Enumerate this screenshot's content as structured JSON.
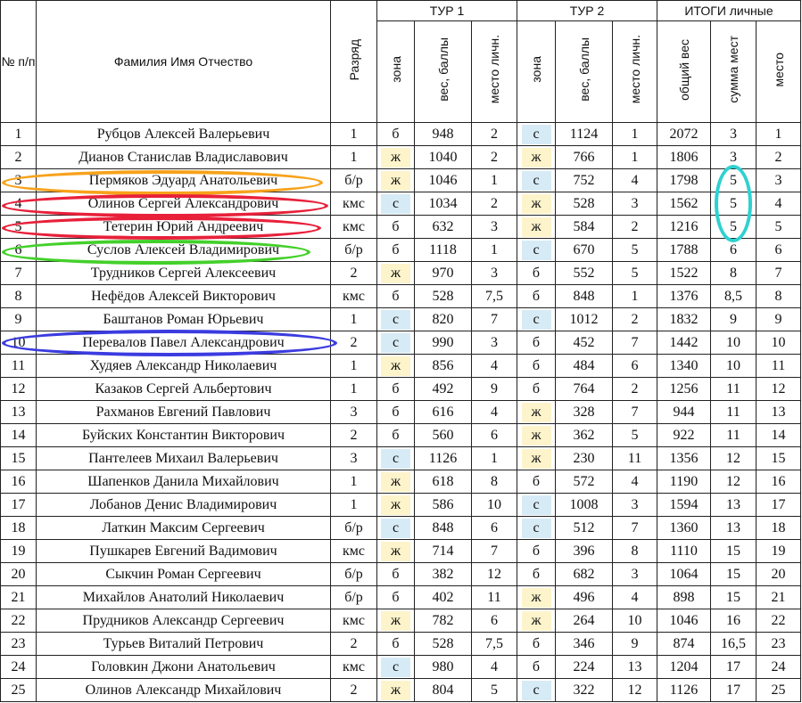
{
  "header": {
    "num": "№ п/п",
    "name": "Фамилия Имя Отчество",
    "rank": "Разряд",
    "tour1": "ТУР 1",
    "tour2": "ТУР 2",
    "totals": "ИТОГИ личные",
    "zone": "зона",
    "weight": "вес, баллы",
    "place_personal": "место личн.",
    "place_personal2": "место личн.",
    "total_weight": "общий вес",
    "sum_places": "сумма мест",
    "place": "место"
  },
  "zone_colors": {
    "б": "transparent",
    "ж": "#fdf4cc",
    "с": "#d7ebf6"
  },
  "highlight_colors": {
    "orange": "#f7a21b",
    "red": "#e8203a",
    "green": "#43d02a",
    "blue": "#3b3be0",
    "cyan": "#2ed1d0"
  },
  "rows": [
    {
      "n": "1",
      "name": "Рубцов Алексей Валерьевич",
      "rank": "1",
      "z1": "б",
      "w1": "948",
      "p1": "2",
      "z2": "с",
      "w2": "1124",
      "p2": "1",
      "tw": "2072",
      "sp": "3",
      "pl": "1"
    },
    {
      "n": "2",
      "name": "Дианов Станислав Владиславович",
      "rank": "1",
      "z1": "ж",
      "w1": "1040",
      "p1": "2",
      "z2": "ж",
      "w2": "766",
      "p2": "1",
      "tw": "1806",
      "sp": "3",
      "pl": "2"
    },
    {
      "n": "3",
      "name": "Пермяков Эдуард Анатольевич",
      "rank": "б/р",
      "z1": "ж",
      "w1": "1046",
      "p1": "1",
      "z2": "с",
      "w2": "752",
      "p2": "4",
      "tw": "1798",
      "sp": "5",
      "pl": "3"
    },
    {
      "n": "4",
      "name": "Олинов Сергей Александрович",
      "rank": "кмс",
      "z1": "с",
      "w1": "1034",
      "p1": "2",
      "z2": "ж",
      "w2": "528",
      "p2": "3",
      "tw": "1562",
      "sp": "5",
      "pl": "4"
    },
    {
      "n": "5",
      "name": "Тетерин Юрий Андреевич",
      "rank": "кмс",
      "z1": "б",
      "w1": "632",
      "p1": "3",
      "z2": "ж",
      "w2": "584",
      "p2": "2",
      "tw": "1216",
      "sp": "5",
      "pl": "5"
    },
    {
      "n": "6",
      "name": "Суслов Алексей Владимирович",
      "rank": "б/р",
      "z1": "б",
      "w1": "1118",
      "p1": "1",
      "z2": "с",
      "w2": "670",
      "p2": "5",
      "tw": "1788",
      "sp": "6",
      "pl": "6"
    },
    {
      "n": "7",
      "name": "Трудников Сергей Алексеевич",
      "rank": "2",
      "z1": "ж",
      "w1": "970",
      "p1": "3",
      "z2": "б",
      "w2": "552",
      "p2": "5",
      "tw": "1522",
      "sp": "8",
      "pl": "7"
    },
    {
      "n": "8",
      "name": "Нефёдов Алексей Викторович",
      "rank": "кмс",
      "z1": "б",
      "w1": "528",
      "p1": "7,5",
      "z2": "б",
      "w2": "848",
      "p2": "1",
      "tw": "1376",
      "sp": "8,5",
      "pl": "8"
    },
    {
      "n": "9",
      "name": "Баштанов Роман Юрьевич",
      "rank": "1",
      "z1": "с",
      "w1": "820",
      "p1": "7",
      "z2": "с",
      "w2": "1012",
      "p2": "2",
      "tw": "1832",
      "sp": "9",
      "pl": "9"
    },
    {
      "n": "10",
      "name": "Перевалов Павел Александрович",
      "rank": "2",
      "z1": "с",
      "w1": "990",
      "p1": "3",
      "z2": "б",
      "w2": "452",
      "p2": "7",
      "tw": "1442",
      "sp": "10",
      "pl": "10"
    },
    {
      "n": "11",
      "name": "Худяев Александр Николаевич",
      "rank": "1",
      "z1": "ж",
      "w1": "856",
      "p1": "4",
      "z2": "б",
      "w2": "484",
      "p2": "6",
      "tw": "1340",
      "sp": "10",
      "pl": "11"
    },
    {
      "n": "12",
      "name": "Казаков Сергей Альбертович",
      "rank": "1",
      "z1": "б",
      "w1": "492",
      "p1": "9",
      "z2": "б",
      "w2": "764",
      "p2": "2",
      "tw": "1256",
      "sp": "11",
      "pl": "12"
    },
    {
      "n": "13",
      "name": "Рахманов Евгений Павлович",
      "rank": "3",
      "z1": "б",
      "w1": "616",
      "p1": "4",
      "z2": "ж",
      "w2": "328",
      "p2": "7",
      "tw": "944",
      "sp": "11",
      "pl": "13"
    },
    {
      "n": "14",
      "name": "Буйских Константин Викторович",
      "rank": "2",
      "z1": "б",
      "w1": "560",
      "p1": "6",
      "z2": "ж",
      "w2": "362",
      "p2": "5",
      "tw": "922",
      "sp": "11",
      "pl": "14"
    },
    {
      "n": "15",
      "name": "Пантелеев Михаил Валерьевич",
      "rank": "3",
      "z1": "с",
      "w1": "1126",
      "p1": "1",
      "z2": "ж",
      "w2": "230",
      "p2": "11",
      "tw": "1356",
      "sp": "12",
      "pl": "15"
    },
    {
      "n": "16",
      "name": "Шапенков Данила Михайлович",
      "rank": "1",
      "z1": "ж",
      "w1": "618",
      "p1": "8",
      "z2": "б",
      "w2": "572",
      "p2": "4",
      "tw": "1190",
      "sp": "12",
      "pl": "16"
    },
    {
      "n": "17",
      "name": "Лобанов Денис Владимирович",
      "rank": "1",
      "z1": "ж",
      "w1": "586",
      "p1": "10",
      "z2": "с",
      "w2": "1008",
      "p2": "3",
      "tw": "1594",
      "sp": "13",
      "pl": "17"
    },
    {
      "n": "18",
      "name": "Латкин Максим Сергеевич",
      "rank": "б/р",
      "z1": "с",
      "w1": "848",
      "p1": "6",
      "z2": "с",
      "w2": "512",
      "p2": "7",
      "tw": "1360",
      "sp": "13",
      "pl": "18"
    },
    {
      "n": "19",
      "name": "Пушкарев Евгений Вадимович",
      "rank": "кмс",
      "z1": "ж",
      "w1": "714",
      "p1": "7",
      "z2": "б",
      "w2": "396",
      "p2": "8",
      "tw": "1110",
      "sp": "15",
      "pl": "19"
    },
    {
      "n": "20",
      "name": "Сыкчин Роман Сергеевич",
      "rank": "б/р",
      "z1": "б",
      "w1": "382",
      "p1": "12",
      "z2": "б",
      "w2": "682",
      "p2": "3",
      "tw": "1064",
      "sp": "15",
      "pl": "20"
    },
    {
      "n": "21",
      "name": "Михайлов Анатолий Николаевич",
      "rank": "б/р",
      "z1": "б",
      "w1": "402",
      "p1": "11",
      "z2": "ж",
      "w2": "496",
      "p2": "4",
      "tw": "898",
      "sp": "15",
      "pl": "21"
    },
    {
      "n": "22",
      "name": "Прудников Александр Сергеевич",
      "rank": "кмс",
      "z1": "ж",
      "w1": "782",
      "p1": "6",
      "z2": "ж",
      "w2": "264",
      "p2": "10",
      "tw": "1046",
      "sp": "16",
      "pl": "22"
    },
    {
      "n": "23",
      "name": "Турьев Виталий Петрович",
      "rank": "2",
      "z1": "б",
      "w1": "528",
      "p1": "7,5",
      "z2": "б",
      "w2": "346",
      "p2": "9",
      "tw": "874",
      "sp": "16,5",
      "pl": "23"
    },
    {
      "n": "24",
      "name": "Головкин Джони Анатольевич",
      "rank": "кмс",
      "z1": "с",
      "w1": "980",
      "p1": "4",
      "z2": "б",
      "w2": "224",
      "p2": "13",
      "tw": "1204",
      "sp": "17",
      "pl": "24"
    },
    {
      "n": "25",
      "name": "Олинов Александр Михайлович",
      "rank": "2",
      "z1": "ж",
      "w1": "804",
      "p1": "5",
      "z2": "с",
      "w2": "322",
      "p2": "12",
      "tw": "1126",
      "sp": "17",
      "pl": "25"
    }
  ]
}
